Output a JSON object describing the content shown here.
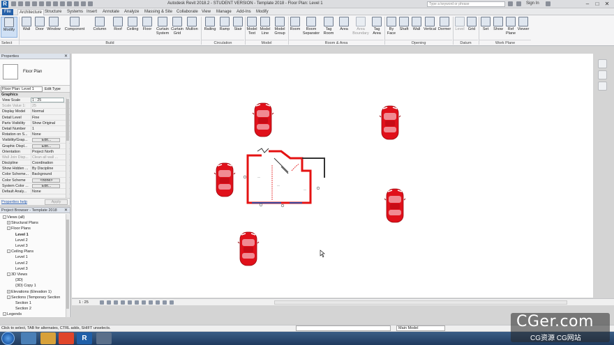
{
  "titlebar": {
    "app_title": "Autodesk Revit 2018.2 - STUDENT VERSION -   Template 2018 - Floor Plan: Level 1",
    "search_placeholder": "Type a keyword or phrase",
    "sign_in": "Sign In"
  },
  "tabs": [
    "File",
    "Architecture",
    "Structure",
    "Systems",
    "Insert",
    "Annotate",
    "Analyze",
    "Massing & Site",
    "Collaborate",
    "View",
    "Manage",
    "Add-Ins",
    "Modify"
  ],
  "active_tab": "Architecture",
  "ribbon": {
    "buttons": [
      "Modify",
      "Wall",
      "Door",
      "Window",
      "Component",
      "Column",
      "Roof",
      "Ceiling",
      "Floor",
      "Curtain System",
      "Curtain Grid",
      "Mullion",
      "Railing",
      "Ramp",
      "Stair",
      "Model Text",
      "Model Line",
      "Model Group",
      "Room",
      "Room Separator",
      "Tag Room",
      "Area",
      "Area Boundary",
      "Tag Area",
      "By Face",
      "Shaft",
      "Wall",
      "Vertical",
      "Dormer",
      "Level",
      "Grid",
      "Set",
      "Show",
      "Ref Plane",
      "Viewer"
    ],
    "groups": [
      "Select",
      "Build",
      "Circulation",
      "Model",
      "Room & Area",
      "Opening",
      "Datum",
      "Work Plane"
    ]
  },
  "properties": {
    "header": "Properties",
    "type_name": "Floor Plan",
    "instance_selector": "Floor Plan: Level 1",
    "edit_type": "Edit Type",
    "group": "Graphics",
    "rows": [
      {
        "k": "View Scale",
        "v": "1 : 25"
      },
      {
        "k": "Scale Value    1:",
        "v": "25"
      },
      {
        "k": "Display Model",
        "v": "Normal"
      },
      {
        "k": "Detail Level",
        "v": "Fine"
      },
      {
        "k": "Parts Visibility",
        "v": "Show Original"
      },
      {
        "k": "Detail Number",
        "v": "1"
      },
      {
        "k": "Rotation on S...",
        "v": "None"
      },
      {
        "k": "Visibility/Grap...",
        "v": "Edit..."
      },
      {
        "k": "Graphic Displ...",
        "v": "Edit..."
      },
      {
        "k": "Orientation",
        "v": "Project North"
      },
      {
        "k": "Wall Join Disp...",
        "v": "Clean all wall ..."
      },
      {
        "k": "Discipline",
        "v": "Coordination"
      },
      {
        "k": "Show Hidden ...",
        "v": "By Discipline"
      },
      {
        "k": "Color Scheme...",
        "v": "Background"
      },
      {
        "k": "Color Scheme",
        "v": "<none>"
      },
      {
        "k": "System Color ...",
        "v": "Edit..."
      },
      {
        "k": "Default Analy...",
        "v": "None"
      }
    ],
    "help_link": "Properties help",
    "apply": "Apply"
  },
  "browser": {
    "header": "Project Browser - Template 2018",
    "items": [
      {
        "label": "Views (all)",
        "level": 0,
        "exp": "-"
      },
      {
        "label": "Structural Plans",
        "level": 1,
        "exp": "+"
      },
      {
        "label": "Floor Plans",
        "level": 1,
        "exp": "-"
      },
      {
        "label": "Level 1",
        "level": 3,
        "exp": "",
        "bold": true
      },
      {
        "label": "Level 2",
        "level": 3,
        "exp": ""
      },
      {
        "label": "Level 3",
        "level": 3,
        "exp": ""
      },
      {
        "label": "Ceiling Plans",
        "level": 1,
        "exp": "-"
      },
      {
        "label": "Level 1",
        "level": 3,
        "exp": ""
      },
      {
        "label": "Level 2",
        "level": 3,
        "exp": ""
      },
      {
        "label": "Level 3",
        "level": 3,
        "exp": ""
      },
      {
        "label": "3D Views",
        "level": 1,
        "exp": "-"
      },
      {
        "label": "{3D}",
        "level": 3,
        "exp": ""
      },
      {
        "label": "{3D} Copy 1",
        "level": 3,
        "exp": ""
      },
      {
        "label": "Elevations (Elevation 1)",
        "level": 1,
        "exp": "+"
      },
      {
        "label": "Sections (Temporary Section",
        "level": 1,
        "exp": "-"
      },
      {
        "label": "Section 1",
        "level": 3,
        "exp": ""
      },
      {
        "label": "Section 2",
        "level": 3,
        "exp": ""
      },
      {
        "label": "Legends",
        "level": 0,
        "exp": "-"
      }
    ]
  },
  "viewbar": {
    "scale": "1 : 25"
  },
  "status": {
    "message": "Click to select, TAB for alternates, CTRL adds, SHIFT unselects.",
    "model": "Main Model"
  },
  "watermark": {
    "big": "CGer.com",
    "small": "CG资源 CG网站"
  },
  "colors": {
    "car": "#e0101a",
    "wall": "#e41212",
    "accent": "#2660a8"
  }
}
